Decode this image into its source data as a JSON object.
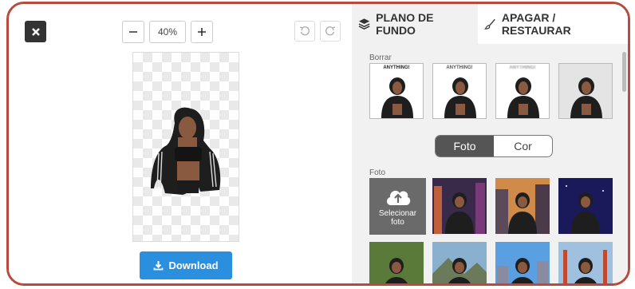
{
  "toolbar": {
    "zoom_value": "40%"
  },
  "actions": {
    "download_label": "Download"
  },
  "tabs": [
    {
      "label": "PLANO DE FUNDO",
      "icon": "layers-icon",
      "active": true
    },
    {
      "label": "APAGAR / RESTAURAR",
      "icon": "brush-icon",
      "active": false
    }
  ],
  "sections": {
    "blur_label": "Borrar",
    "photo_label": "Foto"
  },
  "blur_thumbs_text": "ANYTHING!",
  "toggle": {
    "options": [
      "Foto",
      "Cor"
    ],
    "selected": "Foto"
  },
  "select_photo": {
    "label": "Selecionar foto"
  },
  "colors": {
    "accent": "#2b8fe0",
    "frame": "#b84a3e",
    "dark": "#333333"
  }
}
